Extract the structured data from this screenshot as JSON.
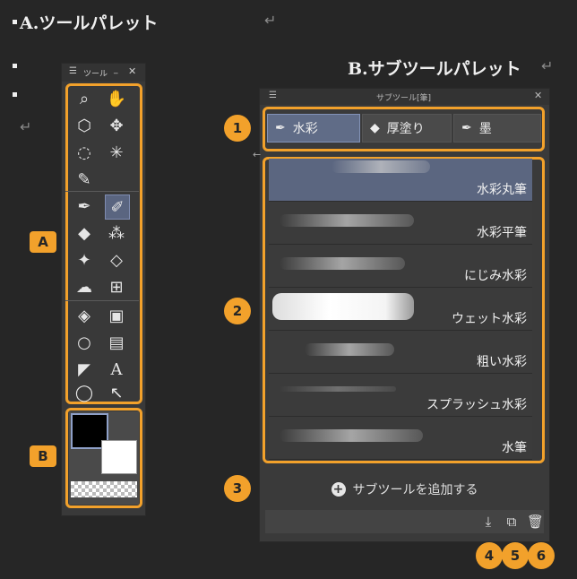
{
  "headings": {
    "a_title": "A.ツールパレット",
    "b_title": "B.サブツールパレット",
    "return_mark": "↵"
  },
  "tool_palette": {
    "title": "ツール",
    "tools": [
      "zoom-icon",
      "hand-icon",
      "object-select-icon",
      "move-icon",
      "lasso-icon",
      "magic-wand-icon",
      "eyedropper-icon",
      "pen-icon",
      "pencil-icon",
      "marker-icon",
      "airbrush-icon",
      "decoration-icon",
      "eraser-icon",
      "blend-icon",
      "grid-icon",
      "fill-icon",
      "gradient-icon",
      "ellipse-icon",
      "frame-icon",
      "ruler-icon",
      "text-icon",
      "balloon-icon",
      "correct-line-icon"
    ],
    "selected_tool": "pencil-icon",
    "callout_a": "A",
    "callout_b": "B"
  },
  "sub_tool_palette": {
    "title": "サブツール[筆]",
    "groups": [
      {
        "label": "水彩",
        "selected": true
      },
      {
        "label": "厚塗り",
        "selected": false
      },
      {
        "label": "墨",
        "selected": false
      }
    ],
    "brushes": [
      {
        "name": "水彩丸筆",
        "selected": true
      },
      {
        "name": "水彩平筆",
        "selected": false
      },
      {
        "name": "にじみ水彩",
        "selected": false
      },
      {
        "name": "ウェット水彩",
        "selected": false
      },
      {
        "name": "粗い水彩",
        "selected": false
      },
      {
        "name": "スプラッシュ水彩",
        "selected": false
      },
      {
        "name": "水筆",
        "selected": false
      }
    ],
    "add_label": "サブツールを追加する",
    "callouts": [
      "1",
      "2",
      "3",
      "4",
      "5",
      "6"
    ]
  },
  "colors": {
    "accent": "#f2a12b",
    "selected": "#5b6680",
    "main_color": "#000000",
    "sub_color": "#ffffff"
  }
}
